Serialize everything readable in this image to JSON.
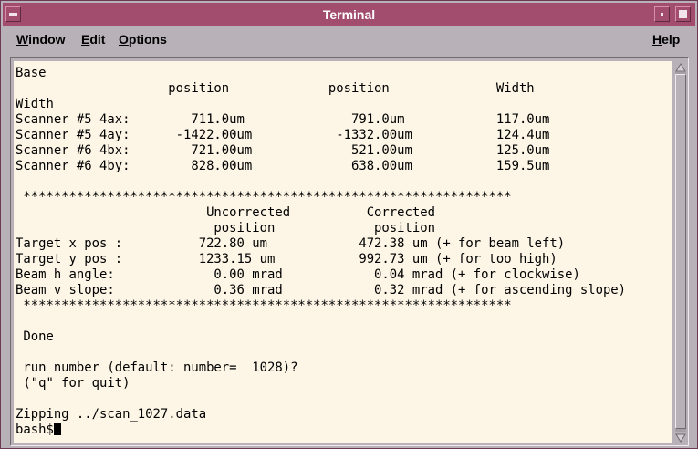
{
  "window": {
    "title": "Terminal"
  },
  "menu": {
    "window": "Window",
    "edit": "Edit",
    "options": "Options",
    "help": "Help"
  },
  "terminal": {
    "lines": [
      "Base",
      "                    position             position              Width",
      "Width",
      "Scanner #5 4ax:        711.0um              791.0um            117.0um",
      "Scanner #5 4ay:      -1422.00um           -1332.00um           124.4um",
      "Scanner #6 4bx:        721.00um             521.00um           125.0um",
      "Scanner #6 4by:        828.00um             638.00um           159.5um",
      "",
      " ****************************************************************",
      "                         Uncorrected          Corrected",
      "                          position             position",
      "Target x pos :          722.80 um            472.38 um (+ for beam left)",
      "Target y pos :          1233.15 um           992.73 um (+ for too high)",
      "Beam h angle:             0.00 mrad            0.04 mrad (+ for clockwise)",
      "Beam v slope:             0.36 mrad            0.32 mrad (+ for ascending slope)",
      " ****************************************************************",
      "",
      " Done",
      "",
      " run number (default: number=  1028)?",
      " (\"q\" for quit)",
      "",
      "Zipping ../scan_1027.data"
    ],
    "prompt": "bash$"
  }
}
